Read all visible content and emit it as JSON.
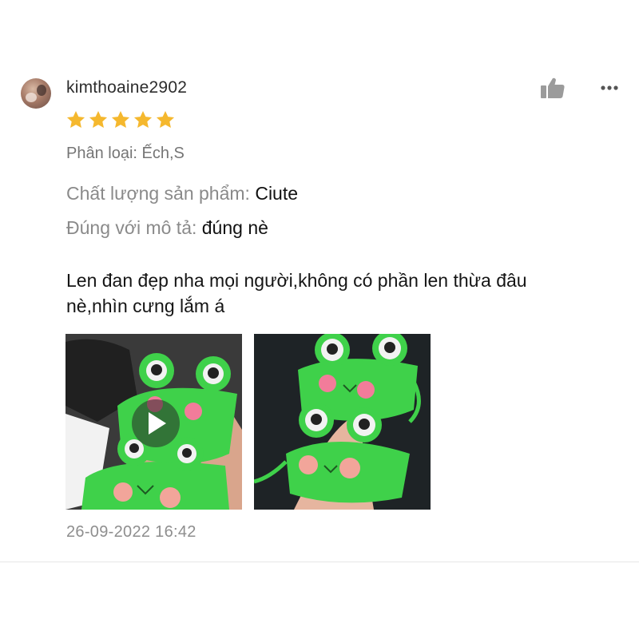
{
  "review": {
    "username": "kimthoaine2902",
    "rating": 5,
    "rating_max": 5,
    "variation_label": "Phân loại: Ếch,S",
    "attributes": {
      "quality": {
        "label": "Chất lượng sản phẩm: ",
        "value": "Ciute"
      },
      "description_match": {
        "label": "Đúng với mô tả: ",
        "value": "đúng nè"
      }
    },
    "comment_line1": "Len đan đẹp nha mọi người,không có phần len thừa đâu",
    "comment_line2": "nè,nhìn cưng lắm á",
    "timestamp": "26-09-2022 16:42",
    "media": [
      {
        "type": "video",
        "icon": "play-icon"
      },
      {
        "type": "photo"
      }
    ]
  },
  "icons": {
    "like": "thumbs-up-icon",
    "more": "more-dots-icon",
    "star": "star-icon"
  },
  "colors": {
    "star": "#f5b82e",
    "icon_gray": "#9b9b9b",
    "frog_green": "#3fd14a",
    "cheek_pink": "#f27c9a"
  }
}
